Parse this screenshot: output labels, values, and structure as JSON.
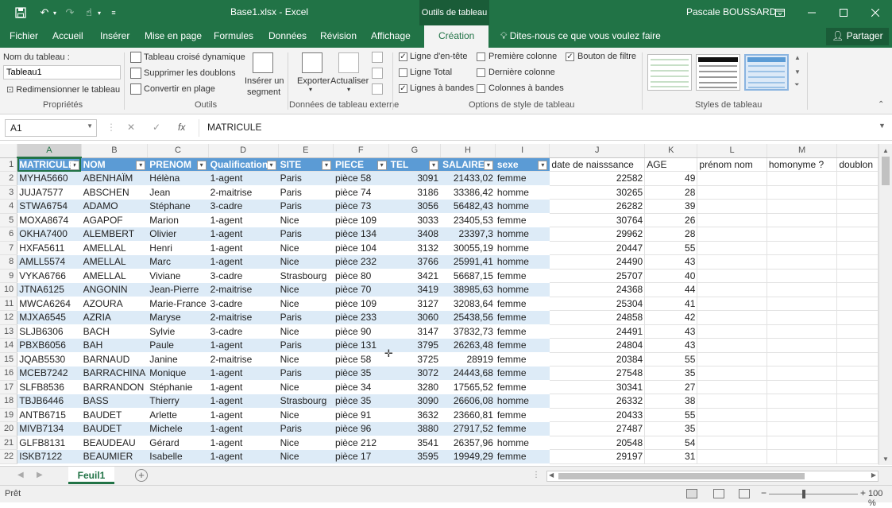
{
  "titlebar": {
    "title": "Base1.xlsx - Excel",
    "context": "Outils de tableau",
    "user": "Pascale BOUSSARD",
    "icons": [
      "save-icon",
      "undo-icon",
      "redo-icon",
      "touch-mode-icon",
      "customize-icon"
    ]
  },
  "tabs": {
    "items": [
      "Fichier",
      "Accueil",
      "Insérer",
      "Mise en page",
      "Formules",
      "Données",
      "Révision",
      "Affichage",
      "Création"
    ],
    "active": "Création",
    "tell": "Dites-nous ce que vous voulez faire",
    "share": "Partager"
  },
  "ribbon": {
    "props": {
      "name_label": "Nom du tableau :",
      "name_value": "Tableau1",
      "resize": "Redimensionner le tableau",
      "group": "Propriétés"
    },
    "tools": {
      "pivot": "Tableau croisé dynamique",
      "dedupe": "Supprimer les doublons",
      "convert": "Convertir en plage",
      "slicer_line1": "Insérer un",
      "slicer_line2": "segment",
      "group": "Outils"
    },
    "ext": {
      "export": "Exporter",
      "refresh": "Actualiser",
      "group": "Données de tableau externe"
    },
    "options": {
      "header_row": "Ligne d'en-tête",
      "total_row": "Ligne Total",
      "banded_rows": "Lignes à bandes",
      "first_col": "Première colonne",
      "last_col": "Dernière colonne",
      "banded_cols": "Colonnes à bandes",
      "filter_btn": "Bouton de filtre",
      "group": "Options de style de tableau"
    },
    "styles": {
      "group": "Styles de tableau"
    }
  },
  "formula": {
    "namebox": "A1",
    "content": "MATRICULE"
  },
  "columns": [
    "A",
    "B",
    "C",
    "D",
    "E",
    "F",
    "G",
    "H",
    "I",
    "J",
    "K",
    "L",
    "M",
    ""
  ],
  "headers": [
    "MATRICULE",
    "NOM",
    "PRENOM",
    "Qualification",
    "SITE",
    "PIECE",
    "TEL",
    "SALAIRE",
    "sexe",
    "date de naisssance",
    "AGE",
    "prénom nom",
    "homonyme ?",
    "doublon"
  ],
  "rows": [
    [
      "MYHA5660",
      "ABENHAÏM",
      "Hélèna",
      "1-agent",
      "Paris",
      "pièce 58",
      "3091",
      "21433,02",
      "femme",
      "22582",
      "49"
    ],
    [
      "JUJA7577",
      "ABSCHEN",
      "Jean",
      "2-maitrise",
      "Paris",
      "pièce 74",
      "3186",
      "33386,42",
      "homme",
      "30265",
      "28"
    ],
    [
      "STWA6754",
      "ADAMO",
      "Stéphane",
      "3-cadre",
      "Paris",
      "pièce 73",
      "3056",
      "56482,43",
      "homme",
      "26282",
      "39"
    ],
    [
      "MOXA8674",
      "AGAPOF",
      "Marion",
      "1-agent",
      "Nice",
      "pièce 109",
      "3033",
      "23405,53",
      "femme",
      "30764",
      "26"
    ],
    [
      "OKHA7400",
      "ALEMBERT",
      "Olivier",
      "1-agent",
      "Paris",
      "pièce 134",
      "3408",
      "23397,3",
      "homme",
      "29962",
      "28"
    ],
    [
      "HXFA5611",
      "AMELLAL",
      "Henri",
      "1-agent",
      "Nice",
      "pièce 104",
      "3132",
      "30055,19",
      "homme",
      "20447",
      "55"
    ],
    [
      "AMLL5574",
      "AMELLAL",
      "Marc",
      "1-agent",
      "Nice",
      "pièce 232",
      "3766",
      "25991,41",
      "homme",
      "24490",
      "43"
    ],
    [
      "VYKA6766",
      "AMELLAL",
      "Viviane",
      "3-cadre",
      "Strasbourg",
      "pièce 80",
      "3421",
      "56687,15",
      "femme",
      "25707",
      "40"
    ],
    [
      "JTNA6125",
      "ANGONIN",
      "Jean-Pierre",
      "2-maitrise",
      "Nice",
      "pièce 70",
      "3419",
      "38985,63",
      "homme",
      "24368",
      "44"
    ],
    [
      "MWCA6264",
      "AZOURA",
      "Marie-France",
      "3-cadre",
      "Nice",
      "pièce 109",
      "3127",
      "32083,64",
      "femme",
      "25304",
      "41"
    ],
    [
      "MJXA6545",
      "AZRIA",
      "Maryse",
      "2-maitrise",
      "Paris",
      "pièce 233",
      "3060",
      "25438,56",
      "femme",
      "24858",
      "42"
    ],
    [
      "SLJB6306",
      "BACH",
      "Sylvie",
      "3-cadre",
      "Nice",
      "pièce 90",
      "3147",
      "37832,73",
      "femme",
      "24491",
      "43"
    ],
    [
      "PBXB6056",
      "BAH",
      "Paule",
      "1-agent",
      "Paris",
      "pièce 131",
      "3795",
      "26263,48",
      "femme",
      "24804",
      "43"
    ],
    [
      "JQAB5530",
      "BARNAUD",
      "Janine",
      "2-maitrise",
      "Nice",
      "pièce 58",
      "3725",
      "28919",
      "femme",
      "20384",
      "55"
    ],
    [
      "MCEB7242",
      "BARRACHINA",
      "Monique",
      "1-agent",
      "Paris",
      "pièce 35",
      "3072",
      "24443,68",
      "femme",
      "27548",
      "35"
    ],
    [
      "SLFB8536",
      "BARRANDON",
      "Stéphanie",
      "1-agent",
      "Nice",
      "pièce 34",
      "3280",
      "17565,52",
      "femme",
      "30341",
      "27"
    ],
    [
      "TBJB6446",
      "BASS",
      "Thierry",
      "1-agent",
      "Strasbourg",
      "pièce 35",
      "3090",
      "26606,08",
      "homme",
      "26332",
      "38"
    ],
    [
      "ANTB6715",
      "BAUDET",
      "Arlette",
      "1-agent",
      "Nice",
      "pièce 91",
      "3632",
      "23660,81",
      "femme",
      "20433",
      "55"
    ],
    [
      "MIVB7134",
      "BAUDET",
      "Michele",
      "1-agent",
      "Paris",
      "pièce 96",
      "3880",
      "27917,52",
      "femme",
      "27487",
      "35"
    ],
    [
      "GLFB8131",
      "BEAUDEAU",
      "Gérard",
      "1-agent",
      "Nice",
      "pièce 212",
      "3541",
      "26357,96",
      "homme",
      "20548",
      "54"
    ],
    [
      "ISKB7122",
      "BEAUMIER",
      "Isabelle",
      "1-agent",
      "Nice",
      "pièce 17",
      "3595",
      "19949,29",
      "femme",
      "29197",
      "31"
    ]
  ],
  "sheet_tab": "Feuil1",
  "status": {
    "ready": "Prêt",
    "zoom": "100 %"
  }
}
